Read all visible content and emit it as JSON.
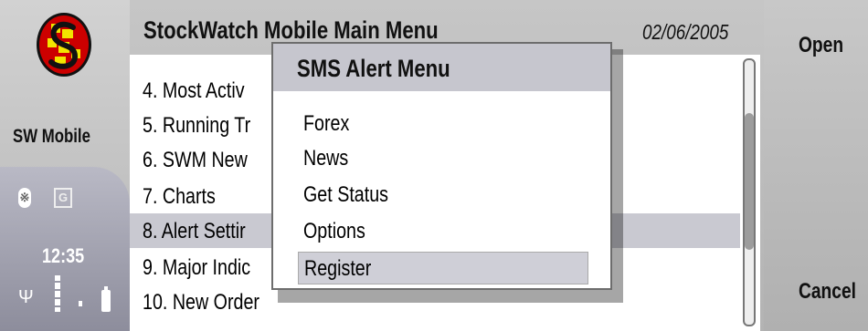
{
  "header": {
    "title": "StockWatch Mobile Main Menu",
    "date": "02/06/2005"
  },
  "status": {
    "app_name": "SW Mobile",
    "clock": "12:35",
    "bluetooth_icon": "bluetooth-icon",
    "gprs_icon": "gprs-icon",
    "network_letter": "G"
  },
  "main_menu": {
    "items": [
      {
        "label": "4. Most Activ"
      },
      {
        "label": "5. Running Tr"
      },
      {
        "label": "6. SWM New"
      },
      {
        "label": "7. Charts"
      },
      {
        "label": "8. Alert Settir"
      },
      {
        "label": "9. Major Indic"
      },
      {
        "label": "10. New Order"
      }
    ],
    "selected_index": 4
  },
  "popup": {
    "title": "SMS Alert Menu",
    "items": [
      {
        "label": "Forex"
      },
      {
        "label": "News"
      },
      {
        "label": "Get Status"
      },
      {
        "label": "Options"
      },
      {
        "label": "Register"
      }
    ],
    "selected_index": 4
  },
  "softkeys": {
    "open": "Open",
    "cancel": "Cancel"
  },
  "colors": {
    "chrome": "#c6c6c6",
    "selection": "#c9c9d1",
    "logo_red": "#cc0000",
    "logo_yellow": "#f2e600"
  }
}
